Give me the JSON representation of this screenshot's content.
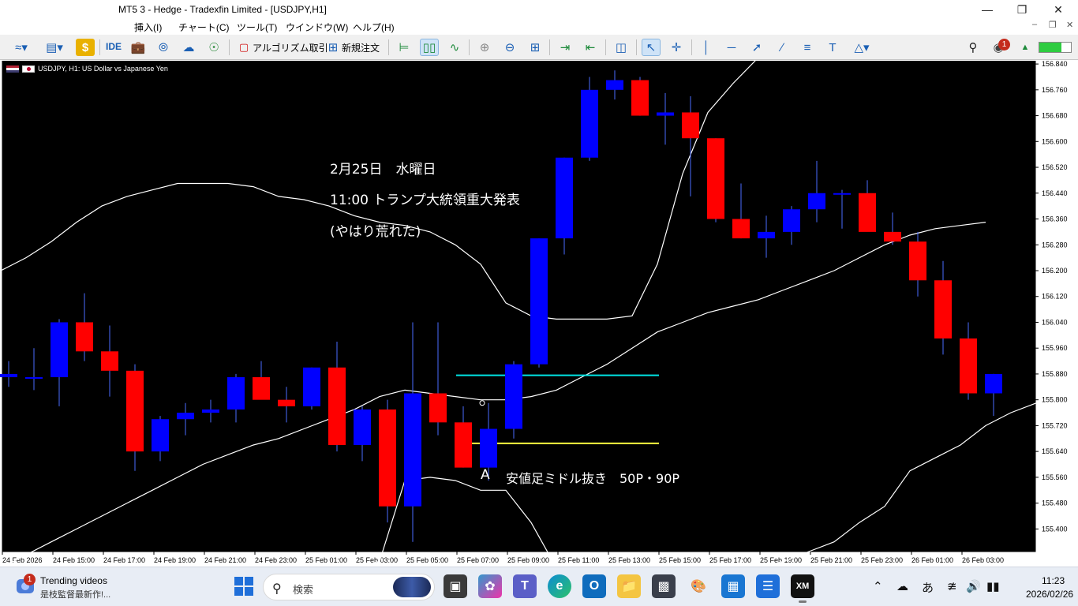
{
  "window": {
    "title": "MT5 3 - Hedge - Tradexfin Limited - [USDJPY,H1]"
  },
  "menu": {
    "items": [
      "挿入(I)",
      "チャート(C)",
      "ツール(T)",
      "ウインドウ(W)",
      "ヘルプ(H)"
    ]
  },
  "toolbar": {
    "ide_label": "IDE",
    "algo_label": "アルゴリズム取引",
    "new_order_label": "新規注文",
    "notification_count": "1"
  },
  "chart": {
    "header": "USDJPY, H1:  US Dollar vs Japanese Yen",
    "annotations": {
      "line1": "2月25日　水曜日",
      "line2": "11:00  トランプ大統領重大発表",
      "line3": "(やはり荒れた)",
      "marker": "A",
      "marker_note": "安値足ミドル抜き　50P・90P"
    },
    "colors": {
      "background": "#000000",
      "bull": "#0000ff",
      "bear": "#ff0000",
      "band": "#ffffff",
      "cyan_line": "#00e5e5",
      "yellow_line": "#ffff40"
    }
  },
  "chart_data": {
    "type": "candlestick",
    "symbol": "USDJPY",
    "timeframe": "H1",
    "y_ticks": [
      "156.840",
      "156.760",
      "156.680",
      "156.600",
      "156.520",
      "156.440",
      "156.360",
      "156.280",
      "156.200",
      "156.120",
      "156.040",
      "155.960",
      "155.880",
      "155.800",
      "155.720",
      "155.640",
      "155.560",
      "155.480",
      "155.400"
    ],
    "x_ticks": [
      "24 Feb 2026",
      "24 Feb 15:00",
      "24 Feb 17:00",
      "24 Feb 19:00",
      "24 Feb 21:00",
      "24 Feb 23:00",
      "25 Feb 01:00",
      "25 Feb 03:00",
      "25 Feb 05:00",
      "25 Feb 07:00",
      "25 Feb 09:00",
      "25 Feb 11:00",
      "25 Feb 13:00",
      "25 Feb 15:00",
      "25 Feb 17:00",
      "25 Feb 19:00",
      "25 Feb 21:00",
      "25 Feb 23:00",
      "26 Feb 01:00",
      "26 Feb 03:00"
    ],
    "ylim": [
      155.33,
      156.85
    ],
    "candles": [
      [
        155.87,
        155.92,
        155.84,
        155.88
      ],
      [
        155.87,
        155.96,
        155.83,
        155.87
      ],
      [
        155.87,
        156.05,
        155.78,
        156.04
      ],
      [
        156.04,
        156.13,
        155.92,
        155.95
      ],
      [
        155.95,
        156.03,
        155.81,
        155.89
      ],
      [
        155.89,
        155.91,
        155.58,
        155.64
      ],
      [
        155.64,
        155.75,
        155.61,
        155.74
      ],
      [
        155.74,
        155.79,
        155.69,
        155.76
      ],
      [
        155.76,
        155.8,
        155.73,
        155.77
      ],
      [
        155.77,
        155.88,
        155.73,
        155.87
      ],
      [
        155.87,
        155.92,
        155.82,
        155.8
      ],
      [
        155.8,
        155.84,
        155.73,
        155.78
      ],
      [
        155.78,
        155.9,
        155.77,
        155.9
      ],
      [
        155.9,
        155.98,
        155.64,
        155.66
      ],
      [
        155.66,
        155.78,
        155.61,
        155.77
      ],
      [
        155.77,
        155.8,
        155.42,
        155.47
      ],
      [
        155.47,
        156.04,
        155.36,
        155.82
      ],
      [
        155.82,
        156.04,
        155.69,
        155.73
      ],
      [
        155.73,
        155.78,
        155.59,
        155.59
      ],
      [
        155.59,
        155.79,
        155.55,
        155.71
      ],
      [
        155.71,
        155.92,
        155.68,
        155.91
      ],
      [
        155.91,
        156.3,
        155.9,
        156.3
      ],
      [
        156.3,
        156.55,
        156.25,
        156.55
      ],
      [
        156.55,
        156.8,
        156.54,
        156.76
      ],
      [
        156.76,
        156.82,
        156.73,
        156.79
      ],
      [
        156.79,
        156.8,
        156.68,
        156.68
      ],
      [
        156.68,
        156.75,
        156.59,
        156.69
      ],
      [
        156.69,
        156.74,
        156.43,
        156.61
      ],
      [
        156.61,
        156.61,
        156.35,
        156.36
      ],
      [
        156.36,
        156.47,
        156.3,
        156.3
      ],
      [
        156.3,
        156.37,
        156.24,
        156.32
      ],
      [
        156.32,
        156.4,
        156.28,
        156.39
      ],
      [
        156.39,
        156.54,
        156.35,
        156.44
      ],
      [
        156.44,
        156.45,
        156.33,
        156.44
      ],
      [
        156.44,
        156.48,
        156.33,
        156.32
      ],
      [
        156.32,
        156.38,
        156.28,
        156.29
      ],
      [
        156.29,
        156.32,
        156.12,
        156.17
      ],
      [
        156.17,
        156.23,
        155.94,
        155.99
      ],
      [
        155.99,
        156.04,
        155.8,
        155.82
      ],
      [
        155.82,
        155.88,
        155.75,
        155.88
      ]
    ],
    "bollinger": {
      "upper": [
        156.2,
        156.24,
        156.29,
        156.35,
        156.4,
        156.43,
        156.45,
        156.47,
        156.47,
        156.47,
        156.46,
        156.43,
        156.42,
        156.4,
        156.37,
        156.35,
        156.34,
        156.32,
        156.28,
        156.22,
        156.1,
        156.06,
        156.05,
        156.05,
        156.05,
        156.06,
        156.22,
        156.5,
        156.69,
        156.78,
        156.86,
        156.92,
        156.98,
        156.98,
        156.98,
        156.98,
        156.98,
        156.98,
        156.98,
        156.98
      ],
      "middle": [
        155.28,
        155.32,
        155.36,
        155.4,
        155.44,
        155.48,
        155.52,
        155.56,
        155.6,
        155.63,
        155.66,
        155.68,
        155.71,
        155.74,
        155.77,
        155.81,
        155.83,
        155.82,
        155.81,
        155.8,
        155.8,
        155.81,
        155.83,
        155.87,
        155.91,
        155.96,
        156.01,
        156.04,
        156.07,
        156.09,
        156.11,
        156.14,
        156.17,
        156.2,
        156.24,
        156.28,
        156.31,
        156.33,
        156.34,
        156.35
      ],
      "lower": [
        155.22,
        155.24,
        155.26,
        155.28,
        155.28,
        155.28,
        155.28,
        155.28,
        155.28,
        155.28,
        155.28,
        155.28,
        155.28,
        155.28,
        155.28,
        155.3,
        155.55,
        155.56,
        155.55,
        155.52,
        155.52,
        155.42,
        155.28,
        155.18,
        155.1,
        155.1,
        155.1,
        155.1,
        155.1,
        155.12,
        155.28,
        155.3,
        155.33,
        155.36,
        155.42,
        155.47,
        155.58,
        155.62,
        155.66,
        155.72,
        155.76,
        155.79
      ]
    },
    "hlines": [
      {
        "price": 155.876,
        "color": "cyan"
      },
      {
        "price": 155.665,
        "color": "yellow"
      }
    ]
  }
}
